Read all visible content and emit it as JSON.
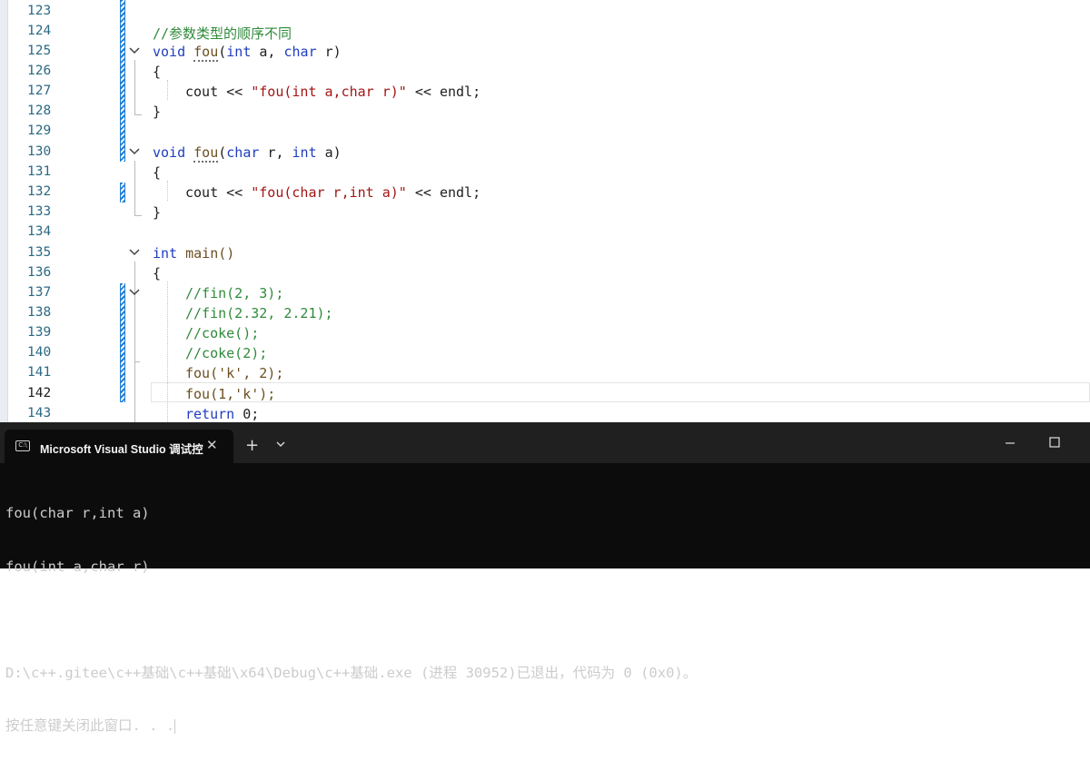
{
  "editor": {
    "lines": [
      {
        "n": "123"
      },
      {
        "n": "124",
        "comment": "//参数类型的顺序不同"
      },
      {
        "n": "125",
        "t1": "void",
        "t2": "fou",
        "t3": "(",
        "t4": "int",
        "t5": " a, ",
        "t6": "char",
        "t7": " r)"
      },
      {
        "n": "126",
        "brace": "{"
      },
      {
        "n": "127",
        "a": "cout << ",
        "s": "\"fou(int a,char r)\"",
        "b": " << endl;"
      },
      {
        "n": "128",
        "brace": "}"
      },
      {
        "n": "129"
      },
      {
        "n": "130",
        "t1": "void",
        "t2": "fou",
        "t3": "(",
        "t4": "char",
        "t5": " r, ",
        "t6": "int",
        "t7": " a)"
      },
      {
        "n": "131",
        "brace": "{"
      },
      {
        "n": "132",
        "a": "cout << ",
        "s": "\"fou(char r,int a)\"",
        "b": " << endl;"
      },
      {
        "n": "133",
        "brace": "}"
      },
      {
        "n": "134"
      },
      {
        "n": "135",
        "t1": "int",
        "t2": " main()"
      },
      {
        "n": "136",
        "brace": "{"
      },
      {
        "n": "137",
        "comment": "//fin(2, 3);"
      },
      {
        "n": "138",
        "comment": "//fin(2.32, 2.21);"
      },
      {
        "n": "139",
        "comment": "//coke();"
      },
      {
        "n": "140",
        "comment": "//coke(2);"
      },
      {
        "n": "141",
        "code": "fou('k', 2);"
      },
      {
        "n": "142",
        "code": "fou(1,'k');"
      },
      {
        "n": "143",
        "t1": "return",
        "t2": " 0;"
      }
    ]
  },
  "terminal": {
    "tab_title": "Microsoft Visual Studio 调试控",
    "tab_icon_text": "C:\\",
    "close_glyph": "✕",
    "new_tab_glyph": "+",
    "output": [
      "fou(char r,int a)",
      "fou(int a,char r)",
      "",
      "D:\\c++.gitee\\c++基础\\c++基础\\x64\\Debug\\c++基础.exe (进程 30952)已退出，代码为 0 (0x0)。",
      "按任意键关闭此窗口. . ."
    ]
  },
  "colors": {
    "keyword": "#1f3dbf",
    "comment": "#2f8a3a",
    "string": "#a31515",
    "line_number": "#2b6a84",
    "change_marker": "#1f7ed6",
    "terminal_bg": "#0c0c0c"
  }
}
